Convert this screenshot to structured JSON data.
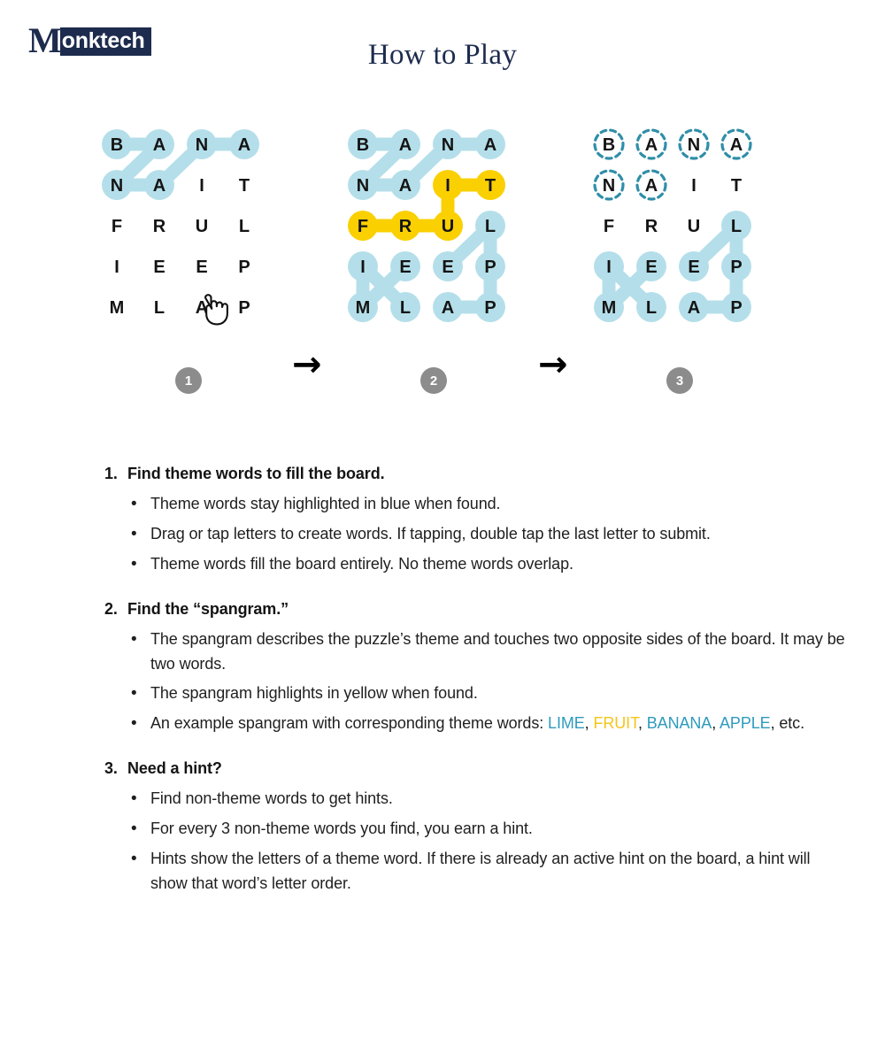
{
  "brand": {
    "logo_m": "M",
    "logo_rest": "onktech"
  },
  "header": {
    "title": "How to Play"
  },
  "diagram": {
    "arrow_glyph": "→",
    "steps": [
      {
        "label": "1"
      },
      {
        "label": "2"
      },
      {
        "label": "3"
      }
    ],
    "board_letters": [
      [
        "B",
        "A",
        "N",
        "A"
      ],
      [
        "N",
        "A",
        "I",
        "T"
      ],
      [
        "F",
        "R",
        "U",
        "L"
      ],
      [
        "I",
        "E",
        "E",
        "P"
      ],
      [
        "M",
        "L",
        "A",
        "P"
      ]
    ],
    "panels": [
      {
        "name": "step-1-board",
        "caption": "1",
        "cursor": {
          "row": 4,
          "col": 2,
          "icon": "pointing-hand-icon"
        },
        "words": [
          {
            "word": "BANANA",
            "color": "blue",
            "path": [
              [
                0,
                0
              ],
              [
                0,
                1
              ],
              [
                1,
                0
              ],
              [
                1,
                1
              ],
              [
                0,
                2
              ],
              [
                0,
                3
              ]
            ]
          }
        ]
      },
      {
        "name": "step-2-board",
        "caption": "2",
        "words": [
          {
            "word": "BANANA",
            "color": "blue",
            "path": [
              [
                0,
                0
              ],
              [
                0,
                1
              ],
              [
                1,
                0
              ],
              [
                1,
                1
              ],
              [
                0,
                2
              ],
              [
                0,
                3
              ]
            ]
          },
          {
            "word": "FRUIT",
            "color": "yellow",
            "path": [
              [
                2,
                0
              ],
              [
                2,
                1
              ],
              [
                2,
                2
              ],
              [
                1,
                2
              ],
              [
                1,
                3
              ]
            ]
          },
          {
            "word": "LIME",
            "color": "blue",
            "path": [
              [
                4,
                1
              ],
              [
                3,
                0
              ],
              [
                4,
                0
              ],
              [
                3,
                1
              ]
            ]
          },
          {
            "word": "APPLE",
            "color": "blue",
            "path": [
              [
                4,
                2
              ],
              [
                4,
                3
              ],
              [
                3,
                3
              ],
              [
                2,
                3
              ],
              [
                3,
                2
              ]
            ]
          }
        ]
      },
      {
        "name": "step-3-board",
        "caption": "3",
        "words": [
          {
            "word": "BANANA",
            "color": "hint",
            "path": [
              [
                0,
                0
              ],
              [
                0,
                1
              ],
              [
                1,
                0
              ],
              [
                1,
                1
              ],
              [
                0,
                2
              ],
              [
                0,
                3
              ]
            ]
          },
          {
            "word": "LIME",
            "color": "blue",
            "path": [
              [
                4,
                1
              ],
              [
                3,
                0
              ],
              [
                4,
                0
              ],
              [
                3,
                1
              ]
            ]
          },
          {
            "word": "APPLE",
            "color": "blue",
            "path": [
              [
                4,
                2
              ],
              [
                4,
                3
              ],
              [
                3,
                3
              ],
              [
                2,
                3
              ],
              [
                3,
                2
              ]
            ]
          }
        ]
      }
    ]
  },
  "colors": {
    "blue_fill": "#b4dfea",
    "yellow_fill": "#fad000",
    "hint_stroke": "#2f8ea8",
    "letter": "#141414",
    "badge": "#8c8c8c",
    "brand_navy": "#1d2b4e",
    "link_blue": "#2e9bbd",
    "link_yellow": "#f5c518"
  },
  "instructions": [
    {
      "num": "1.",
      "title": "Find theme words to fill the board.",
      "bullets": [
        "Theme words stay highlighted in blue when found.",
        "Drag or tap letters to create words. If tapping, double tap the last letter to submit.",
        "Theme words fill the board entirely. No theme words overlap."
      ]
    },
    {
      "num": "2.",
      "title": "Find the “spangram.”",
      "bullets": [
        "The spangram describes the puzzle’s theme and touches two opposite sides of the board. It may be two words.",
        "The spangram highlights in yellow when found."
      ],
      "example_bullet": {
        "lead": "An example spangram with corresponding theme words: ",
        "words": [
          "LIME",
          "FRUIT",
          "BANANA",
          "APPLE"
        ],
        "sep": ", ",
        "tail": ", etc."
      }
    },
    {
      "num": "3.",
      "title": "Need a hint?",
      "bullets": [
        "Find non-theme words to get hints.",
        "For every 3 non-theme words you find, you earn a hint.",
        "Hints show the letters of a theme word. If there is already an active hint on the board, a hint will show that word’s letter order."
      ]
    }
  ]
}
